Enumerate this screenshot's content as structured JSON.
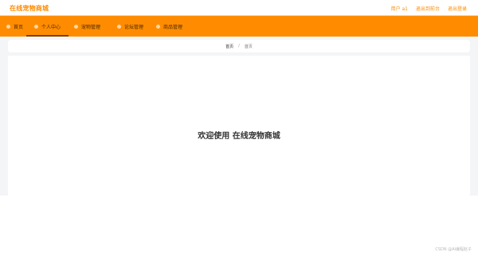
{
  "header": {
    "brand": "在线宠物商城",
    "user_label": "用户 a1",
    "back_to_frontend": "退出到前台",
    "logout": "退出登录"
  },
  "nav": {
    "items": [
      {
        "label": "首页"
      },
      {
        "label": "个人中心"
      },
      {
        "label": "宠物管理"
      },
      {
        "label": "论坛管理"
      },
      {
        "label": "商品管理"
      }
    ],
    "active_index": 1
  },
  "breadcrumb": {
    "home": "首页",
    "separator": "/",
    "current": "首页"
  },
  "main": {
    "welcome": "欢迎使用 在线宠物商城"
  },
  "watermark": "CSDN @Ai编程赵子"
}
